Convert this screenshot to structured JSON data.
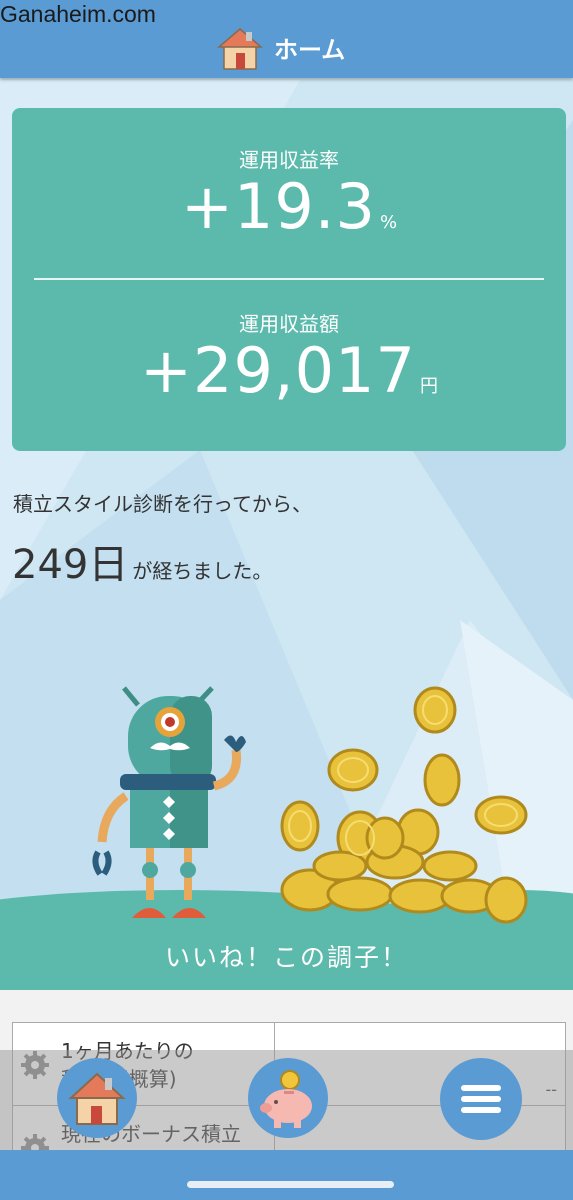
{
  "watermark": "Ganaheim.com",
  "header": {
    "title": "ホーム",
    "icon": "house-icon"
  },
  "stats": {
    "rate_label": "運用収益率",
    "rate_value": "+19.3",
    "rate_unit": "%",
    "amount_label": "運用収益額",
    "amount_value": "+29,017",
    "amount_unit": "円"
  },
  "diagnosis": {
    "line1": "積立スタイル診断を行ってから、",
    "days": "249日",
    "suffix": "が経ちました。"
  },
  "illustration": {
    "slogan": "いいね！この調子！"
  },
  "info_rows": [
    {
      "label_line1": "1ヶ月あたりの",
      "label_line2": "積立額(概算)",
      "value": "--",
      "icon": "gear-icon"
    },
    {
      "label_line1": "現在のボーナス積立",
      "label_line2": "",
      "value": "--",
      "icon": "gear-icon"
    }
  ],
  "bottom_nav": [
    {
      "name": "home",
      "icon": "house-icon"
    },
    {
      "name": "savings",
      "icon": "piggy-bank-icon"
    },
    {
      "name": "menu",
      "icon": "menu-icon"
    }
  ],
  "colors": {
    "header": "#5b9bd3",
    "card": "#5cbaad",
    "background": "#cfe6f3"
  }
}
